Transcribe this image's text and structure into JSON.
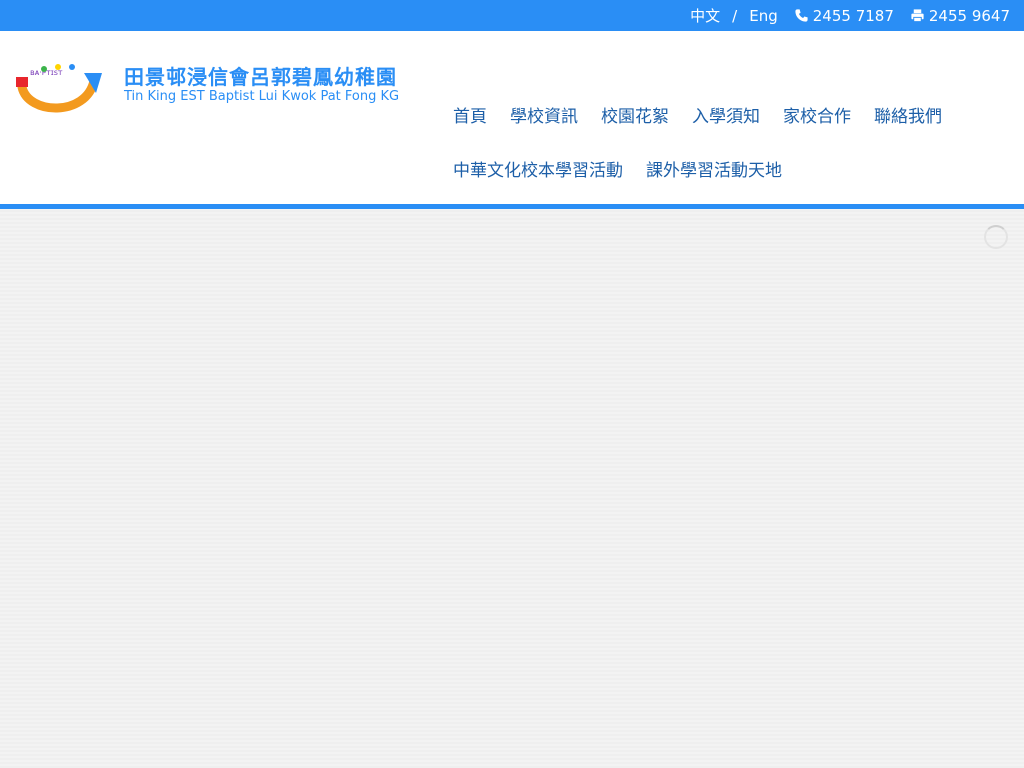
{
  "topbar": {
    "lang_zh": "中文",
    "separator": "/",
    "lang_en": "Eng",
    "phone": "2455 7187",
    "fax": "2455 9647"
  },
  "header": {
    "school_name_zh": "田景邨浸信會呂郭碧鳳幼稚園",
    "school_name_en": "Tin King EST Baptist Lui Kwok Pat Fong KG"
  },
  "nav": {
    "row1": [
      "首頁",
      "學校資訊",
      "校園花絮",
      "入學須知",
      "家校合作",
      "聯絡我們"
    ],
    "row2": [
      "中華文化校本學習活動",
      "課外學習活動天地"
    ]
  },
  "colors": {
    "brand_blue": "#2a8ef5",
    "nav_text": "#1d5fa8"
  }
}
